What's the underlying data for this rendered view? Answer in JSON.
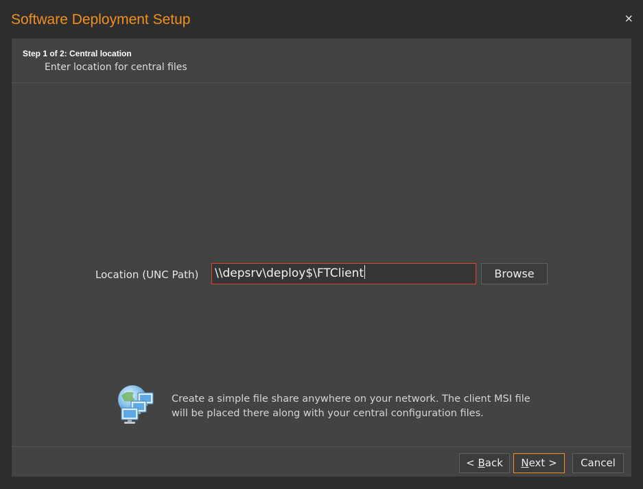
{
  "window": {
    "title": "Software Deployment Setup",
    "close_glyph": "×",
    "accent_color": "#f0901e"
  },
  "header": {
    "step": "Step 1 of 2: Central location",
    "subtitle": "Enter location for central files"
  },
  "location": {
    "label": "Location (UNC Path)",
    "value": "\\\\depsrv\\deploy$\\FTClient",
    "error_border_color": "#e0452d",
    "browse_label": "Browse"
  },
  "info": {
    "icon": "network-computers-icon",
    "text": "Create a simple file share anywhere on your network. The client MSI file will be placed there along with your central configuration files."
  },
  "footer": {
    "back_prefix": "< ",
    "back_mnemonic": "B",
    "back_rest": "ack",
    "next_mnemonic": "N",
    "next_rest": "ext >",
    "cancel_label": "Cancel"
  }
}
